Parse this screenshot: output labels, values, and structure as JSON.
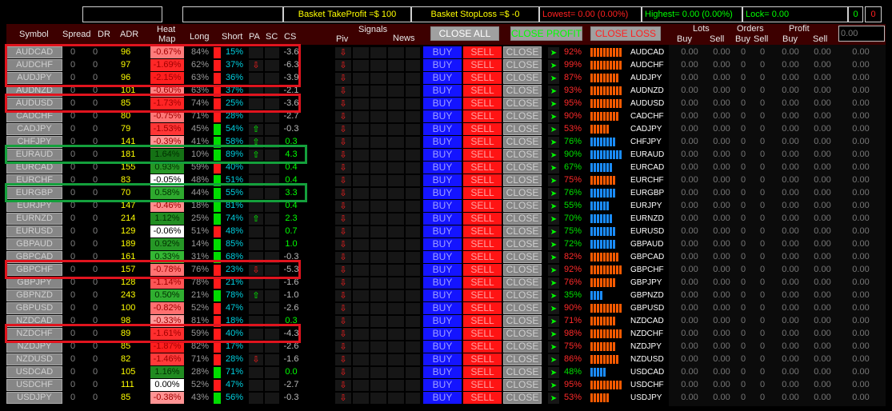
{
  "top_bar": {
    "basket_take_profit": "Basket TakeProfit =$ 100",
    "basket_stop_loss": "Basket StopLoss =$ -0",
    "lowest": "Lowest= 0.00 (0.00%)",
    "highest": "Highest= 0.00 (0.00%)",
    "lock": "Lock= 0.00",
    "counter_green": "0",
    "counter_red": "0"
  },
  "header": {
    "symbol": "Symbol",
    "spread": "Spread",
    "dr": "DR",
    "adr": "ADR",
    "heat": "Heat",
    "map": "Map",
    "long": "Long",
    "short": "Short",
    "pa": "PA",
    "sc": "SC",
    "cs": "CS",
    "signals": "Signals",
    "piv": "Piv",
    "news": "News",
    "close_all": "CLOSE ALL",
    "close_profit": "CLOSE PROFIT",
    "close_loss": "CLOSE LOSS",
    "lots": "Lots",
    "orders": "Orders",
    "profit": "Profit",
    "buy": "Buy",
    "sell": "Sell",
    "input_value": "0.00"
  },
  "labels": {
    "buy": "BUY",
    "sell": "SELL",
    "close": "CLOSE",
    "zero": "0",
    "zero_dec": "0.00"
  },
  "pairs": [
    {
      "symbol": "AUDCAD",
      "spread": "0",
      "dr": "0",
      "adr": "96",
      "heat": "-0.67%",
      "long": "84%",
      "short": "15%",
      "pa": "",
      "cs": "-3.6",
      "pct": "92%",
      "name": "AUDCAD",
      "bars": 10,
      "dir": "down"
    },
    {
      "symbol": "AUDCHF",
      "spread": "0",
      "dr": "0",
      "adr": "97",
      "heat": "-1.69%",
      "long": "62%",
      "short": "37%",
      "pa": "down",
      "cs": "-6.3",
      "pct": "99%",
      "name": "AUDCHF",
      "bars": 10,
      "dir": "down"
    },
    {
      "symbol": "AUDJPY",
      "spread": "0",
      "dr": "0",
      "adr": "96",
      "heat": "-2.15%",
      "long": "63%",
      "short": "36%",
      "pa": "",
      "cs": "-3.9",
      "pct": "87%",
      "name": "AUDJPY",
      "bars": 9,
      "dir": "down"
    },
    {
      "symbol": "AUDNZD",
      "spread": "0",
      "dr": "0",
      "adr": "101",
      "heat": "-0.60%",
      "long": "63%",
      "short": "37%",
      "pa": "",
      "cs": "-2.1",
      "pct": "93%",
      "name": "AUDNZD",
      "bars": 10,
      "dir": "down"
    },
    {
      "symbol": "AUDUSD",
      "spread": "0",
      "dr": "0",
      "adr": "85",
      "heat": "-1.73%",
      "long": "74%",
      "short": "25%",
      "pa": "",
      "cs": "-3.6",
      "pct": "95%",
      "name": "AUDUSD",
      "bars": 10,
      "dir": "down"
    },
    {
      "symbol": "CADCHF",
      "spread": "0",
      "dr": "0",
      "adr": "80",
      "heat": "-0.75%",
      "long": "71%",
      "short": "28%",
      "pa": "",
      "cs": "-2.7",
      "pct": "90%",
      "name": "CADCHF",
      "bars": 9,
      "dir": "down"
    },
    {
      "symbol": "CADJPY",
      "spread": "0",
      "dr": "0",
      "adr": "79",
      "heat": "-1.53%",
      "long": "45%",
      "short": "54%",
      "pa": "up",
      "cs": "-0.3",
      "pct": "53%",
      "name": "CADJPY",
      "bars": 6,
      "dir": "down"
    },
    {
      "symbol": "CHFJPY",
      "spread": "0",
      "dr": "0",
      "adr": "141",
      "heat": "-0.39%",
      "long": "41%",
      "short": "58%",
      "pa": "up",
      "cs": "0.3",
      "pct": "76%",
      "name": "CHFJPY",
      "bars": 8,
      "dir": "up"
    },
    {
      "symbol": "EURAUD",
      "spread": "0",
      "dr": "0",
      "adr": "181",
      "heat": "1.64%",
      "long": "10%",
      "short": "89%",
      "pa": "up",
      "cs": "4.3",
      "pct": "90%",
      "name": "EURAUD",
      "bars": 10,
      "dir": "up"
    },
    {
      "symbol": "EURCAD",
      "spread": "0",
      "dr": "0",
      "adr": "155",
      "heat": "0.93%",
      "long": "59%",
      "short": "40%",
      "pa": "",
      "cs": "0.4",
      "pct": "67%",
      "name": "EURCAD",
      "bars": 7,
      "dir": "up"
    },
    {
      "symbol": "EURCHF",
      "spread": "0",
      "dr": "0",
      "adr": "83",
      "heat": "-0.05%",
      "long": "48%",
      "short": "51%",
      "pa": "",
      "cs": "0.4",
      "pct": "75%",
      "name": "EURCHF",
      "bars": 8,
      "dir": "down"
    },
    {
      "symbol": "EURGBP",
      "spread": "0",
      "dr": "0",
      "adr": "70",
      "heat": "0.58%",
      "long": "44%",
      "short": "55%",
      "pa": "",
      "cs": "3.3",
      "pct": "76%",
      "name": "EURGBP",
      "bars": 8,
      "dir": "up"
    },
    {
      "symbol": "EURJPY",
      "spread": "0",
      "dr": "0",
      "adr": "147",
      "heat": "-0.46%",
      "long": "18%",
      "short": "81%",
      "pa": "",
      "cs": "0.4",
      "pct": "55%",
      "name": "EURJPY",
      "bars": 6,
      "dir": "up"
    },
    {
      "symbol": "EURNZD",
      "spread": "0",
      "dr": "0",
      "adr": "214",
      "heat": "1.12%",
      "long": "25%",
      "short": "74%",
      "pa": "up",
      "cs": "2.3",
      "pct": "70%",
      "name": "EURNZD",
      "bars": 7,
      "dir": "up"
    },
    {
      "symbol": "EURUSD",
      "spread": "0",
      "dr": "0",
      "adr": "129",
      "heat": "-0.06%",
      "long": "51%",
      "short": "48%",
      "pa": "",
      "cs": "0.7",
      "pct": "75%",
      "name": "EURUSD",
      "bars": 8,
      "dir": "up"
    },
    {
      "symbol": "GBPAUD",
      "spread": "0",
      "dr": "0",
      "adr": "189",
      "heat": "0.92%",
      "long": "14%",
      "short": "85%",
      "pa": "",
      "cs": "1.0",
      "pct": "72%",
      "name": "GBPAUD",
      "bars": 8,
      "dir": "up"
    },
    {
      "symbol": "GBPCAD",
      "spread": "0",
      "dr": "0",
      "adr": "161",
      "heat": "0.33%",
      "long": "31%",
      "short": "68%",
      "pa": "",
      "cs": "-0.3",
      "pct": "82%",
      "name": "GBPCAD",
      "bars": 9,
      "dir": "down"
    },
    {
      "symbol": "GBPCHF",
      "spread": "0",
      "dr": "0",
      "adr": "157",
      "heat": "-0.78%",
      "long": "76%",
      "short": "23%",
      "pa": "down",
      "cs": "-5.3",
      "pct": "92%",
      "name": "GBPCHF",
      "bars": 10,
      "dir": "down"
    },
    {
      "symbol": "GBPJPY",
      "spread": "0",
      "dr": "0",
      "adr": "128",
      "heat": "-1.14%",
      "long": "78%",
      "short": "21%",
      "pa": "",
      "cs": "-1.6",
      "pct": "76%",
      "name": "GBPJPY",
      "bars": 8,
      "dir": "down"
    },
    {
      "symbol": "GBPNZD",
      "spread": "0",
      "dr": "0",
      "adr": "243",
      "heat": "0.50%",
      "long": "21%",
      "short": "78%",
      "pa": "up",
      "cs": "-1.0",
      "pct": "35%",
      "name": "GBPNZD",
      "bars": 4,
      "dir": "up"
    },
    {
      "symbol": "GBPUSD",
      "spread": "0",
      "dr": "0",
      "adr": "100",
      "heat": "-0.82%",
      "long": "52%",
      "short": "47%",
      "pa": "",
      "cs": "-2.6",
      "pct": "90%",
      "name": "GBPUSD",
      "bars": 10,
      "dir": "down"
    },
    {
      "symbol": "NZDCAD",
      "spread": "0",
      "dr": "0",
      "adr": "98",
      "heat": "-0.33%",
      "long": "81%",
      "short": "18%",
      "pa": "",
      "cs": "0.3",
      "pct": "71%",
      "name": "NZDCAD",
      "bars": 8,
      "dir": "down"
    },
    {
      "symbol": "NZDCHF",
      "spread": "0",
      "dr": "0",
      "adr": "89",
      "heat": "-1.61%",
      "long": "59%",
      "short": "40%",
      "pa": "",
      "cs": "-4.3",
      "pct": "98%",
      "name": "NZDCHF",
      "bars": 10,
      "dir": "down"
    },
    {
      "symbol": "NZDJPY",
      "spread": "0",
      "dr": "0",
      "adr": "85",
      "heat": "-1.87%",
      "long": "82%",
      "short": "17%",
      "pa": "",
      "cs": "-2.6",
      "pct": "75%",
      "name": "NZDJPY",
      "bars": 8,
      "dir": "down"
    },
    {
      "symbol": "NZDUSD",
      "spread": "0",
      "dr": "0",
      "adr": "82",
      "heat": "-1.46%",
      "long": "71%",
      "short": "28%",
      "pa": "down",
      "cs": "-1.6",
      "pct": "86%",
      "name": "NZDUSD",
      "bars": 9,
      "dir": "down"
    },
    {
      "symbol": "USDCAD",
      "spread": "0",
      "dr": "0",
      "adr": "105",
      "heat": "1.16%",
      "long": "28%",
      "short": "71%",
      "pa": "",
      "cs": "0.0",
      "pct": "48%",
      "name": "USDCAD",
      "bars": 5,
      "dir": "up"
    },
    {
      "symbol": "USDCHF",
      "spread": "0",
      "dr": "0",
      "adr": "111",
      "heat": "0.00%",
      "long": "52%",
      "short": "47%",
      "pa": "",
      "cs": "-2.7",
      "pct": "95%",
      "name": "USDCHF",
      "bars": 10,
      "dir": "down"
    },
    {
      "symbol": "USDJPY",
      "spread": "0",
      "dr": "0",
      "adr": "85",
      "heat": "-0.38%",
      "long": "43%",
      "short": "56%",
      "pa": "",
      "cs": "-0.3",
      "pct": "53%",
      "name": "USDJPY",
      "bars": 6,
      "dir": "down"
    }
  ],
  "highlights": {
    "red": [
      "AUDCAD-AUDJPY",
      "AUDUSD",
      "GBPCHF",
      "NZDCHF"
    ],
    "green": [
      "EURAUD",
      "EURGBP"
    ]
  },
  "colors": {
    "header_bg": "#3d0000",
    "buy": "#1414ff",
    "sell": "#ff1414",
    "neg_pct": "#ff2a2a",
    "pos_pct": "#00e000",
    "bar_down": "#ff5a00",
    "bar_up": "#1a8cff",
    "highlight_red": "#e0141e",
    "highlight_green": "#14a03c"
  }
}
